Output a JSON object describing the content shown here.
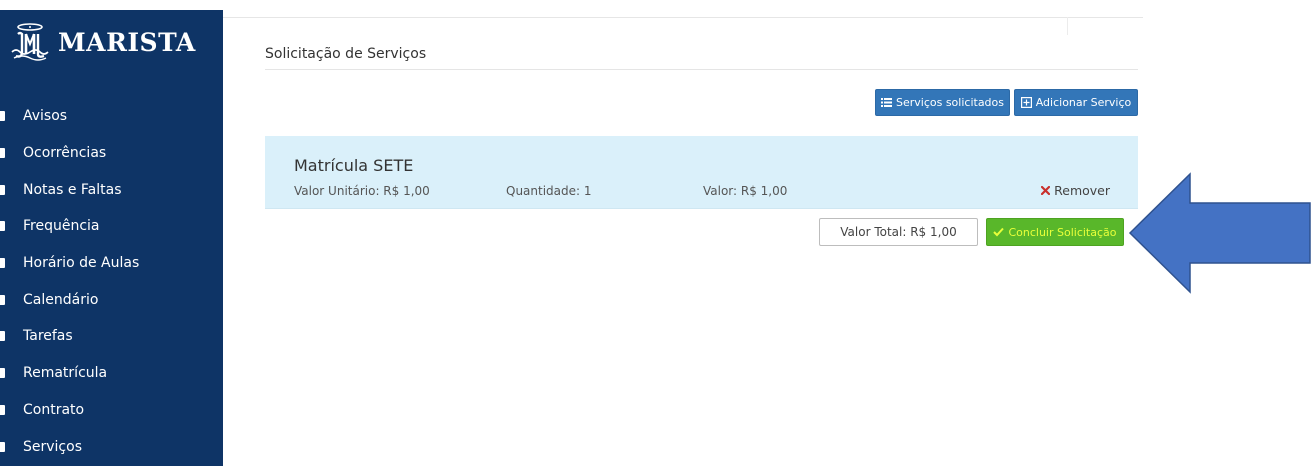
{
  "sidebar": {
    "brand": "MARISTA",
    "items": [
      {
        "label": "Avisos"
      },
      {
        "label": "Ocorrências"
      },
      {
        "label": "Notas e Faltas"
      },
      {
        "label": "Frequência"
      },
      {
        "label": "Horário de Aulas"
      },
      {
        "label": "Calendário"
      },
      {
        "label": "Tarefas"
      },
      {
        "label": "Rematrícula"
      },
      {
        "label": "Contrato"
      },
      {
        "label": "Serviços"
      }
    ]
  },
  "main": {
    "title": "Solicitação de Serviços",
    "buttons": {
      "requested_label": "Serviços solicitados",
      "add_label": "Adicionar Serviço"
    },
    "service": {
      "name": "Matrícula SETE",
      "unit_value": "Valor Unitário: R$ 1,00",
      "quantity": "Quantidade: 1",
      "value": "Valor: R$ 1,00",
      "remove_label": "Remover"
    },
    "total": "Valor Total: R$ 1,00",
    "finish_label": "Concluir Solicitação"
  },
  "colors": {
    "sidebar_bg": "#0e3466",
    "primary_button": "#3376b8",
    "panel_bg": "#daf0fa",
    "finish_button": "#59b72a",
    "finish_text": "#e8ff3a",
    "remove_icon": "#c9302c",
    "arrow": "#4472c4"
  },
  "icons": {
    "logo": "marista-emblem-icon",
    "list": "list-icon",
    "add": "plus-square-icon",
    "remove": "times-icon",
    "finish": "check-icon",
    "annotation": "left-arrow-icon"
  }
}
